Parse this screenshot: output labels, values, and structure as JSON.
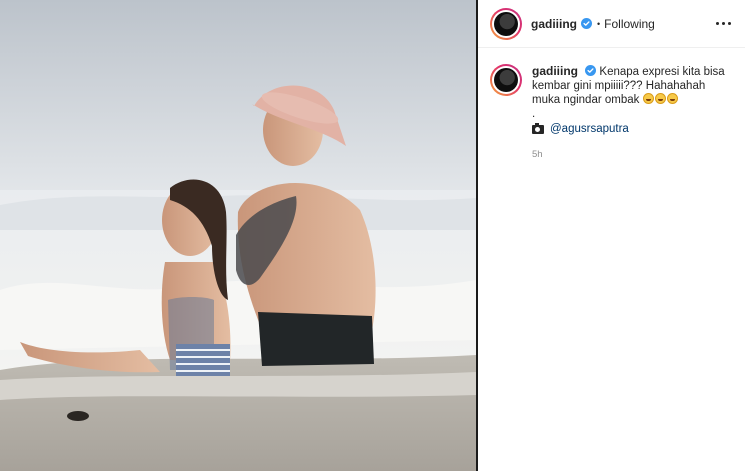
{
  "post": {
    "image_alt": "Man in a pink bucket hat and little girl sitting in the surf at the beach",
    "author": {
      "username": "gadiiing",
      "verified": true,
      "follow_status": "Following"
    },
    "caption": {
      "username": "gadiiing",
      "line1": "Kenapa expresi kita bisa",
      "line2": "kembar gini mpiiiii??? Hahahahah",
      "line3": "muka ngindar ombak",
      "emoji": [
        "rofl-emoji",
        "rofl-emoji",
        "rofl-emoji"
      ],
      "separator": ".",
      "credit_mention": "@agusrsaputra"
    },
    "timestamp": "5h"
  },
  "icons": {
    "verified": "verified-badge-icon",
    "more": "more-options-icon",
    "camera": "camera-icon"
  },
  "colors": {
    "text": "#262626",
    "muted": "#8e8e8e",
    "link": "#00376b",
    "verified": "#3897f0"
  }
}
